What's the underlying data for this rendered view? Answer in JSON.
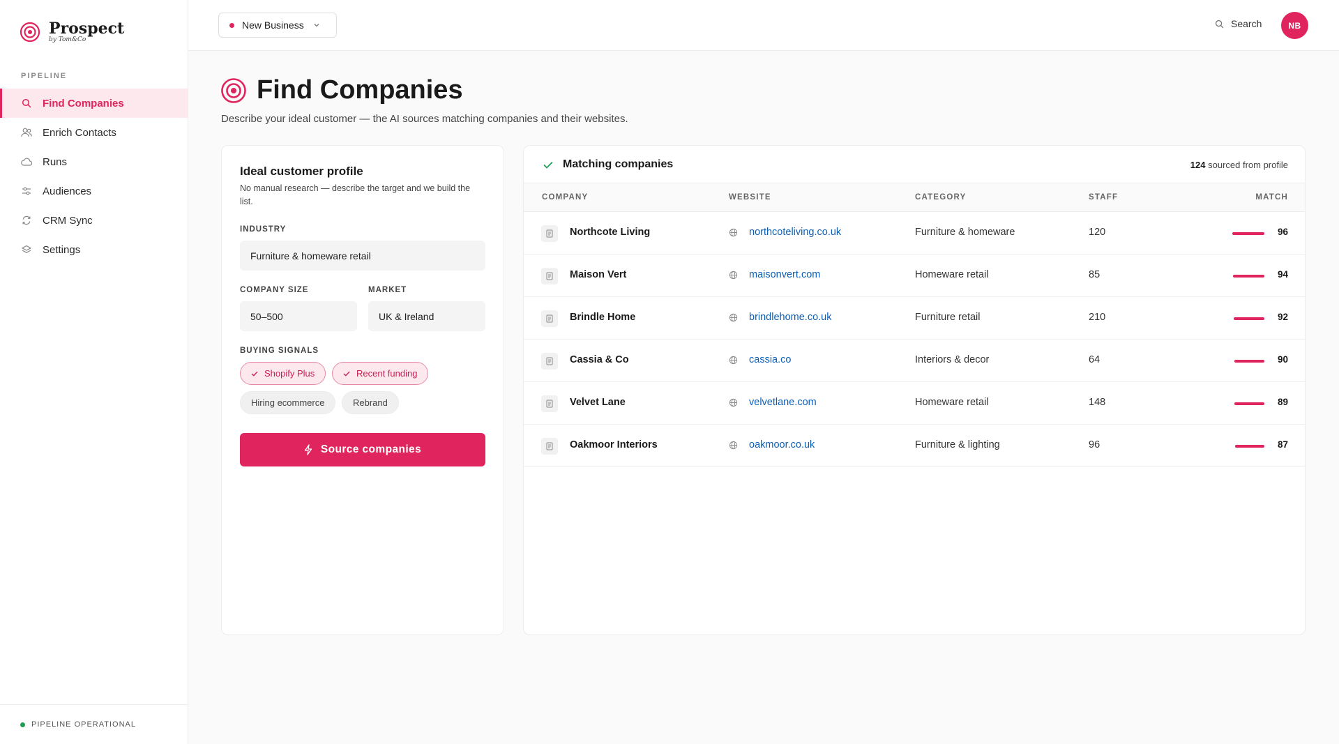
{
  "brand": {
    "name": "Prospect",
    "sub": "by Tom&Co"
  },
  "sidebar": {
    "section_label": "PIPELINE",
    "items": [
      {
        "label": "Find Companies",
        "icon": "search-icon",
        "active": true
      },
      {
        "label": "Enrich Contacts",
        "icon": "users-icon",
        "active": false
      },
      {
        "label": "Runs",
        "icon": "cloud-icon",
        "active": false
      },
      {
        "label": "Audiences",
        "icon": "sliders-icon",
        "active": false
      },
      {
        "label": "CRM Sync",
        "icon": "sync-icon",
        "active": false
      },
      {
        "label": "Settings",
        "icon": "layers-icon",
        "active": false
      }
    ],
    "status": "PIPELINE OPERATIONAL"
  },
  "topbar": {
    "workspace": "New Business",
    "search_label": "Search",
    "avatar_initials": "NB"
  },
  "page": {
    "title": "Find Companies",
    "description": "Describe your ideal customer — the AI sources matching companies and their websites."
  },
  "icp": {
    "title": "Ideal customer profile",
    "description": "No manual research — describe the target and we build the list.",
    "industry_label": "INDUSTRY",
    "industry_value": "Furniture & homeware retail",
    "size_label": "COMPANY SIZE",
    "size_value": "50–500",
    "market_label": "MARKET",
    "market_value": "UK & Ireland",
    "signals_label": "BUYING SIGNALS",
    "signals": [
      {
        "label": "Shopify Plus",
        "selected": true
      },
      {
        "label": "Recent funding",
        "selected": true
      },
      {
        "label": "Hiring ecommerce",
        "selected": false
      },
      {
        "label": "Rebrand",
        "selected": false
      }
    ],
    "cta_label": "Source companies"
  },
  "results": {
    "title": "Matching companies",
    "count": "124",
    "count_suffix": "sourced from profile",
    "columns": [
      "COMPANY",
      "WEBSITE",
      "CATEGORY",
      "STAFF",
      "MATCH"
    ],
    "rows": [
      {
        "company": "Northcote Living",
        "website": "northcoteliving.co.uk",
        "category": "Furniture & homeware",
        "staff": "120",
        "match": "96"
      },
      {
        "company": "Maison Vert",
        "website": "maisonvert.com",
        "category": "Homeware retail",
        "staff": "85",
        "match": "94"
      },
      {
        "company": "Brindle Home",
        "website": "brindlehome.co.uk",
        "category": "Furniture retail",
        "staff": "210",
        "match": "92"
      },
      {
        "company": "Cassia & Co",
        "website": "cassia.co",
        "category": "Interiors & decor",
        "staff": "64",
        "match": "90"
      },
      {
        "company": "Velvet Lane",
        "website": "velvetlane.com",
        "category": "Homeware retail",
        "staff": "148",
        "match": "89"
      },
      {
        "company": "Oakmoor Interiors",
        "website": "oakmoor.co.uk",
        "category": "Furniture & lighting",
        "staff": "96",
        "match": "87"
      }
    ]
  },
  "colors": {
    "accent": "#e0245e",
    "accent_soft": "#fde8ee",
    "link": "#0b5fb8",
    "ok": "#1f9d55"
  }
}
